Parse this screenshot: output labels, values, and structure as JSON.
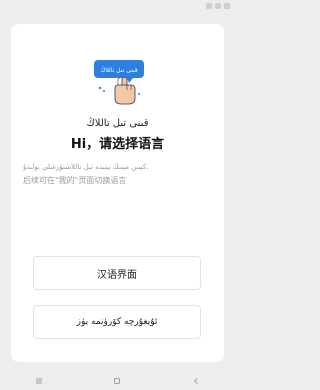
{
  "status_bar": {
    "time": "2:14"
  },
  "illustration": {
    "bubble_text": "قىنى تىل تاللاڭ",
    "bubble_color": "#2f7fe0",
    "hand_color": "#f2c9a4",
    "outline_color": "#2a3550"
  },
  "title": {
    "uyghur": "قىنى تىل تاللاڭ",
    "chinese": "Hi，请选择语言"
  },
  "hint": {
    "uyghur": ".كېيىن مېنىڭ بېتىدە تىل تاللاشتۇرغىلى بولىدۇ",
    "chinese": "后续可在\"我的\"页面切换语言"
  },
  "buttons": {
    "chinese": "汉语界面",
    "uyghur": "ئۇيغۇرچە كۆرۈنمە يۈز"
  }
}
